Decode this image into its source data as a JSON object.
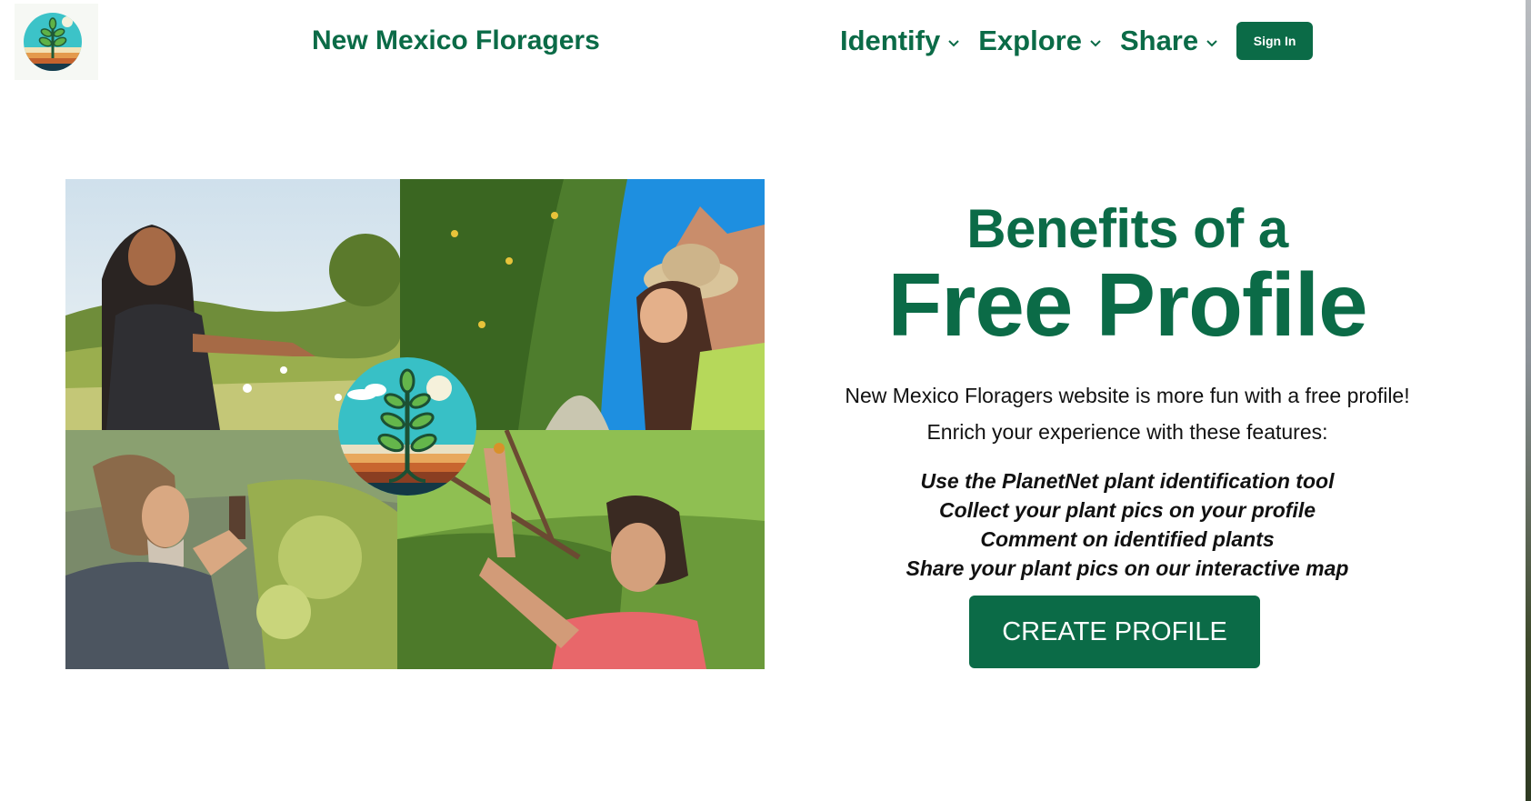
{
  "header": {
    "brand": "New Mexico Floragers",
    "nav": [
      {
        "label": "Identify"
      },
      {
        "label": "Explore"
      },
      {
        "label": "Share"
      }
    ],
    "signin_label": "Sign In"
  },
  "hero": {
    "heading_line1": "Benefits of a",
    "heading_line2": "Free Profile",
    "intro": "New Mexico Floragers website is more fun with a free profile!",
    "intro2": "Enrich your experience with these features:",
    "features": [
      "Use the PlanetNet plant identification tool",
      "Collect your plant pics on your profile",
      "Comment on identified plants",
      "Share your plant pics on our interactive map"
    ],
    "cta_label": "CREATE PROFILE"
  },
  "collage": {
    "photos": [
      {
        "icon": "woman-pointing-at-plants-photo"
      },
      {
        "icon": "woman-tasting-berries-photo"
      },
      {
        "icon": "man-smelling-flowers-photo"
      },
      {
        "icon": "man-examining-leaf-photo"
      }
    ],
    "logo_icon": "plant-sprout-logo"
  },
  "colors": {
    "brand_green": "#0b6b47",
    "text": "#111111"
  }
}
